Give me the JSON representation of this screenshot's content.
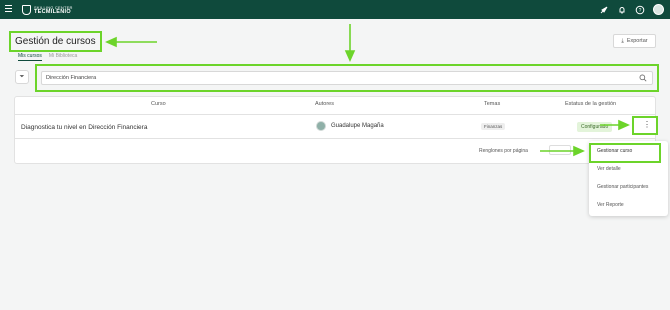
{
  "topbar": {
    "logo_line1": "SKILLING CENTER",
    "logo_line2": "TECMILENIO",
    "icons": [
      "rocket-icon",
      "bell-icon",
      "help-icon",
      "user-avatar"
    ]
  },
  "header": {
    "title": "Gestión de cursos",
    "tabs": [
      "Mis cursos",
      "Mi Biblioteca"
    ],
    "export_label": "Exportar"
  },
  "search": {
    "value": "Dirección Financiera"
  },
  "table": {
    "columns": [
      "Curso",
      "Autores",
      "Temas",
      "Estatus de la gestión"
    ],
    "rows": [
      {
        "course": "Diagnostica tu nivel en Dirección Financiera",
        "author": "Guadalupe Magaña",
        "topic": "Finanzas",
        "status": "Configurado"
      }
    ],
    "pager_label": "Renglones por página"
  },
  "menu": {
    "items": [
      "Gestionar curso",
      "Ver detalle",
      "Gestionar participantes",
      "Ver Reporte"
    ]
  },
  "colors": {
    "topbar": "#0f4a3c",
    "highlight": "#6cd42a"
  }
}
